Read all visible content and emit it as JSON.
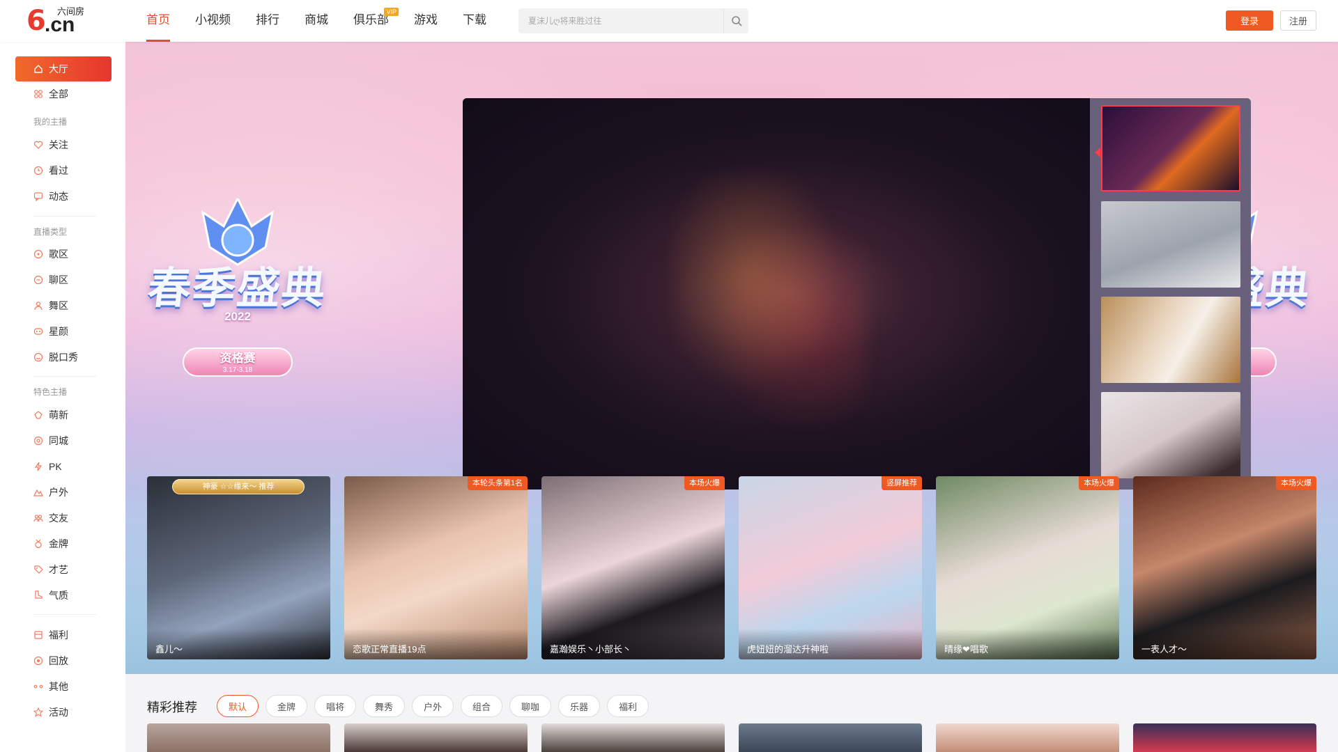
{
  "header": {
    "logo": {
      "mark": "6",
      "domain": ".cn",
      "name": "六间房"
    },
    "nav": [
      {
        "label": "首页"
      },
      {
        "label": "小视频"
      },
      {
        "label": "排行"
      },
      {
        "label": "商城"
      },
      {
        "label": "俱乐部",
        "badge": "VIP"
      },
      {
        "label": "游戏"
      },
      {
        "label": "下载"
      }
    ],
    "search_placeholder": "夏沫儿ღ将来胜过往",
    "login_label": "登录",
    "register_label": "注册"
  },
  "sidebar": {
    "hall": "大厅",
    "all": "全部",
    "my_anchors_title": "我的主播",
    "follow": "关注",
    "watched": "看过",
    "feed": "动态",
    "live_type_title": "直播类型",
    "song": "歌区",
    "chat": "聊区",
    "dance": "舞区",
    "star_face": "星颜",
    "talk_show": "脱口秀",
    "featured_title": "特色主播",
    "newcomer": "萌新",
    "same_city": "同城",
    "pk": "PK",
    "outdoor": "户外",
    "social": "交友",
    "gold": "金牌",
    "talent": "才艺",
    "vibe": "气质",
    "welfare": "福利",
    "replay": "回放",
    "other": "其他",
    "activity": "活动"
  },
  "banner": {
    "event_title": "春季盛典",
    "event_year": "2022",
    "stage_label": "资格赛",
    "stage_dates": "3.17-3.18"
  },
  "live_cards": [
    {
      "name": "鑫儿～",
      "crown": "神豪 ☆☆缘来～ 推荐"
    },
    {
      "name": "恋歌正常直播19点",
      "tag": "本轮头条第1名"
    },
    {
      "name": "嘉瀚娱乐丶小部长丶",
      "tag": "本场火爆"
    },
    {
      "name": "虎妞妞的溜达升神啦",
      "tag": "竖屏推荐"
    },
    {
      "name": "晴缘❤唱歌",
      "tag": "本场火爆"
    },
    {
      "name": "一表人才～",
      "tag": "本场火爆"
    }
  ],
  "recommend": {
    "title": "精彩推荐",
    "filters": [
      "默认",
      "金牌",
      "唱将",
      "舞秀",
      "户外",
      "组合",
      "聊咖",
      "乐器",
      "福利"
    ]
  },
  "colors": {
    "accent": "#ef5a22",
    "brand_red": "#e83a2e"
  }
}
